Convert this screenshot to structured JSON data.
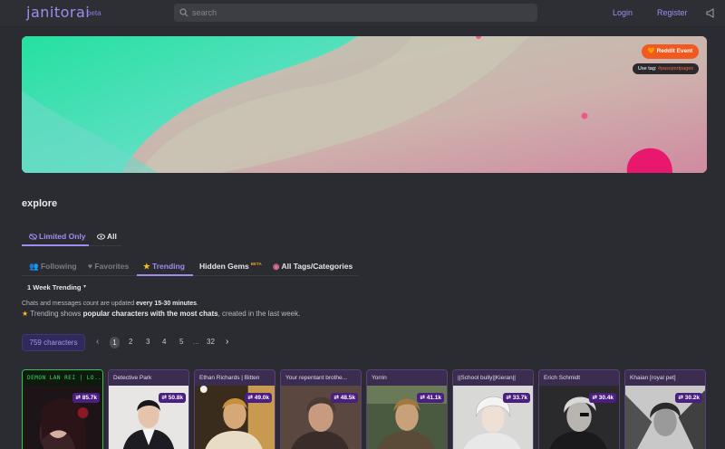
{
  "header": {
    "logo": "janitorai",
    "logo_badge": "beta",
    "search_placeholder": "search",
    "login": "Login",
    "register": "Register"
  },
  "banner": {
    "event_label": "🧡 Reddit Event",
    "tag_prefix": "Use tag:",
    "tag_value": "#passportpages"
  },
  "explore": {
    "title": "explore",
    "filters": [
      "Limited Only",
      "All"
    ],
    "tabs": [
      {
        "label": "Following"
      },
      {
        "label": "Favorites"
      },
      {
        "label": "Trending"
      },
      {
        "label": "Hidden Gems",
        "badge": "BETA"
      },
      {
        "label": "All Tags/Categories"
      }
    ],
    "period": "1 Week Trending",
    "info_line1_a": "Chats and messages count are updated ",
    "info_line1_b": "every 15-30 minutes",
    "info_line1_c": ".",
    "info_line2_a": "Trending shows ",
    "info_line2_b": "popular characters with the most chats",
    "info_line2_c": ", created in the last week."
  },
  "pagination": {
    "count": "759 characters",
    "pages": [
      "1",
      "2",
      "3",
      "4",
      "5",
      "...",
      "32"
    ],
    "current": "1"
  },
  "cards": [
    {
      "title": "DEMON LAN REI | LO...",
      "count": "85.7k"
    },
    {
      "title": "Detective Park",
      "count": "50.8k"
    },
    {
      "title": "Ethan Richards | Bitten",
      "count": "49.0k"
    },
    {
      "title": "Your repentant brothe...",
      "count": "48.5k"
    },
    {
      "title": "Yorrin",
      "count": "41.1k"
    },
    {
      "title": "||School bully||Kieran||",
      "count": "33.7k"
    },
    {
      "title": "Erich Schmidt",
      "count": "30.4k"
    },
    {
      "title": "Khaian [royal pet]",
      "count": "30.2k"
    }
  ],
  "colors": {
    "accent": "#a08cf0",
    "event_orange": "#f05a1e",
    "badge_purple": "#4a1f80",
    "background": "#2b2c31"
  }
}
